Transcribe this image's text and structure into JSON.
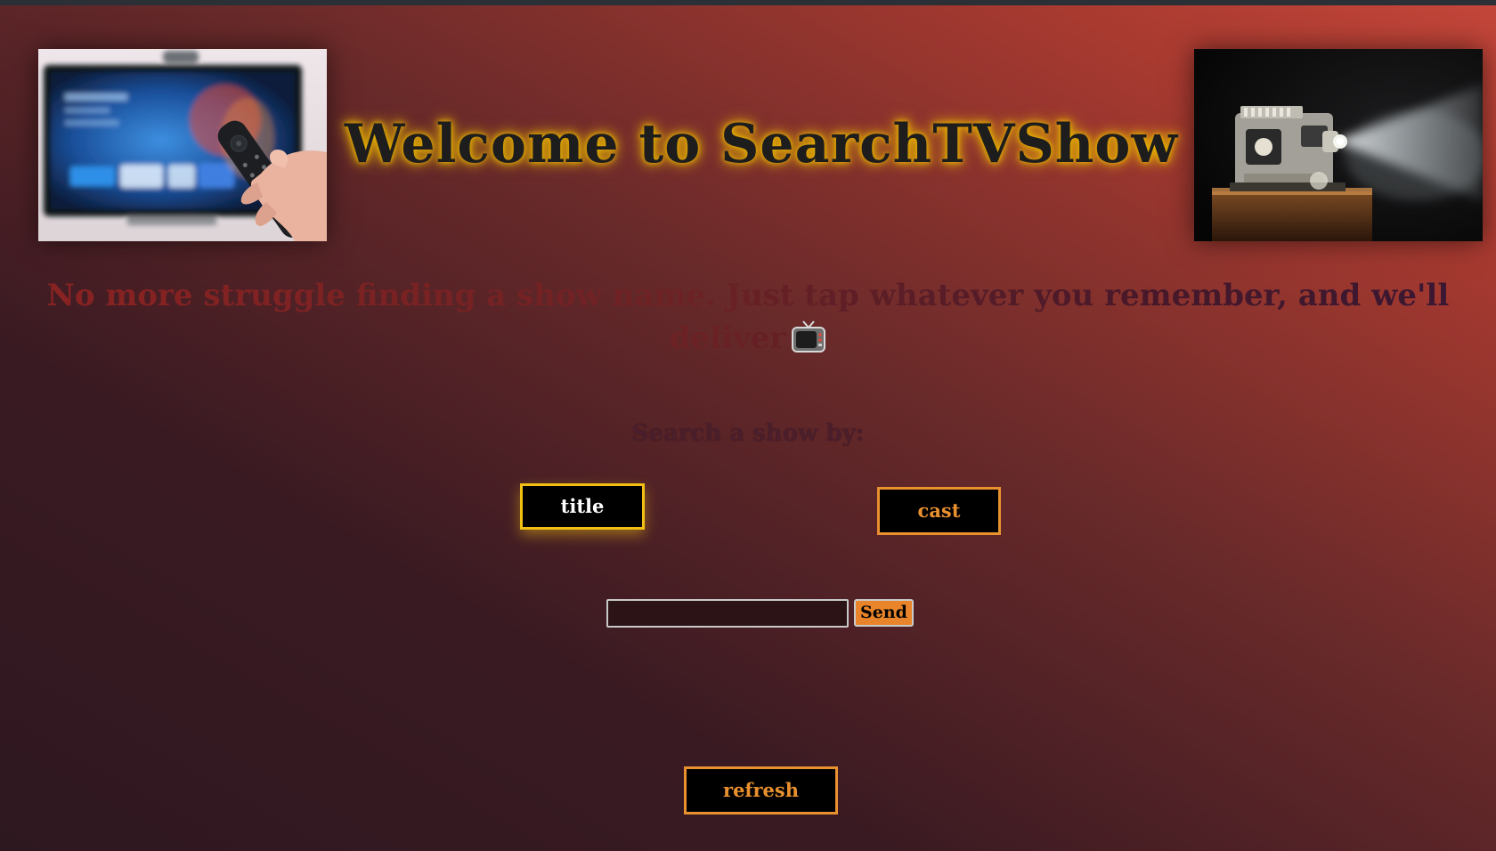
{
  "page": {
    "heading": "Welcome to SearchTVShow",
    "tagline": "No more struggle finding a show name. Just tap whatever you remember, and we'll deliver",
    "tagline_icon": "television-icon",
    "search_by_label": "Search a show by:"
  },
  "images": {
    "left": "tv-remote-image",
    "right": "film-projector-image"
  },
  "options": {
    "title_label": "title",
    "cast_label": "cast"
  },
  "search": {
    "value": "",
    "placeholder": "",
    "send_label": "Send"
  },
  "actions": {
    "refresh_label": "refresh"
  },
  "colors": {
    "heading_glow": "#e8b400",
    "title_border": "#f2c012",
    "cast_border": "#e9902f",
    "send_background": "#e9842a",
    "background_top_right": "#c4463a",
    "background_bottom_left": "#2e1820"
  }
}
